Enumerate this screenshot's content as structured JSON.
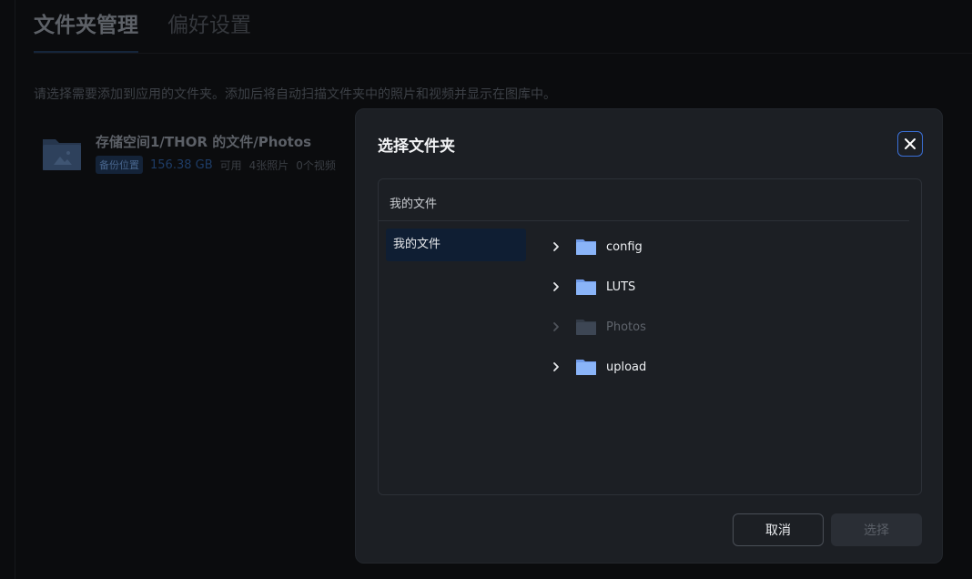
{
  "background": {
    "tabs": [
      {
        "label": "文件夹管理",
        "active": true
      },
      {
        "label": "偏好设置",
        "active": false
      }
    ],
    "description": "请选择需要添加到应用的文件夹。添加后将自动扫描文件夹中的照片和视频并显示在图库中。",
    "folder_card": {
      "title": "存储空间1/THOR 的文件/Photos",
      "badge": "备份位置",
      "size": "156.38 GB",
      "available": "可用",
      "photos": "4张照片",
      "videos": "0个视频"
    }
  },
  "dialog": {
    "title": "选择文件夹",
    "breadcrumb": "我的文件",
    "sidebar": [
      {
        "label": "我的文件",
        "selected": true
      }
    ],
    "folders": [
      {
        "name": "config",
        "disabled": false
      },
      {
        "name": "LUTS",
        "disabled": false
      },
      {
        "name": "Photos",
        "disabled": true
      },
      {
        "name": "upload",
        "disabled": false
      }
    ],
    "cancel_label": "取消",
    "select_label": "选择"
  },
  "colors": {
    "accent": "#3a6fd6",
    "folder_icon": "#8ab4f8",
    "folder_icon_disabled": "#3d4654",
    "dialog_bg": "#1c1f24"
  },
  "icons": {
    "close": "close-icon",
    "chevron": "chevron-right-icon",
    "folder": "folder-icon"
  }
}
